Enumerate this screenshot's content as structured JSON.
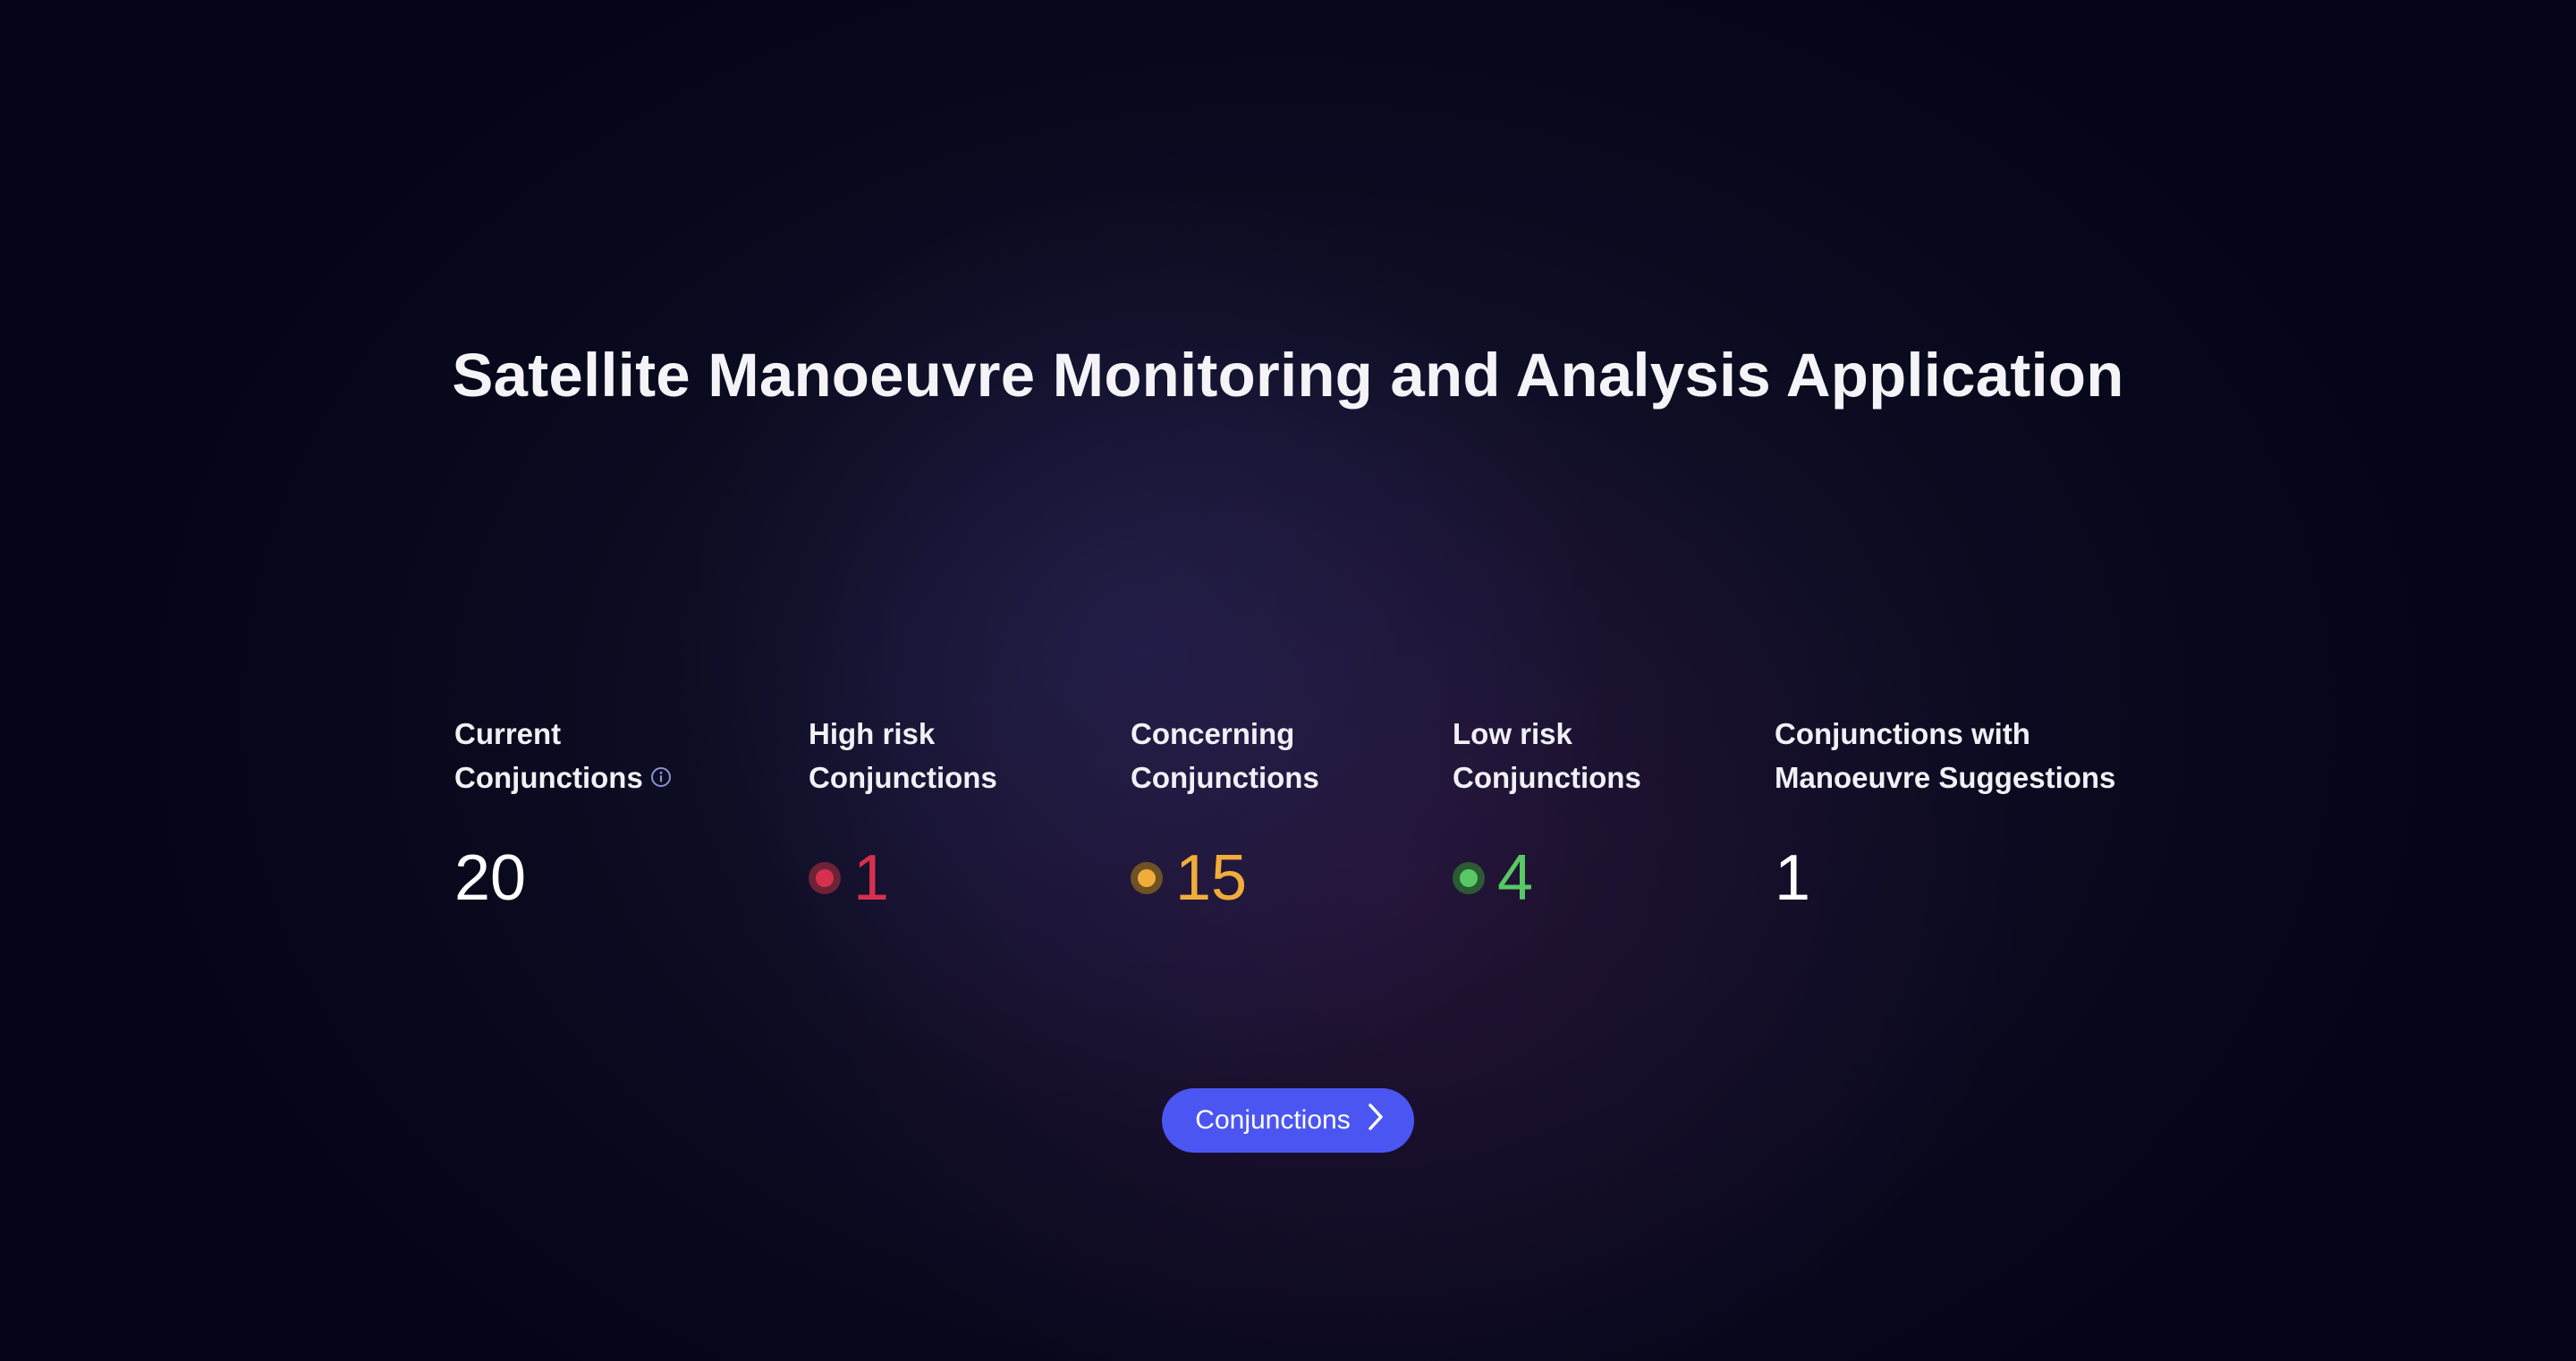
{
  "header": {
    "title": "Satellite Manoeuvre Monitoring and Analysis Application"
  },
  "stats": [
    {
      "label_line1": "Current",
      "label_line2": "Conjunctions",
      "value": "20",
      "icon": "info-icon",
      "color": "#ffffff"
    },
    {
      "label_line1": "High risk",
      "label_line2": "Conjunctions",
      "value": "1",
      "icon": "red-dot-icon",
      "color": "#d6304f"
    },
    {
      "label_line1": "Concerning",
      "label_line2": "Conjunctions",
      "value": "15",
      "icon": "amber-dot-icon",
      "color": "#f1ad3a"
    },
    {
      "label_line1": "Low risk",
      "label_line2": "Conjunctions",
      "value": "4",
      "icon": "green-dot-icon",
      "color": "#58c864"
    },
    {
      "label_line1": "Conjunctions with",
      "label_line2": "Manoeuvre Suggestions",
      "value": "1",
      "color": "#ffffff"
    }
  ],
  "actions": {
    "conjunctions_button_label": "Conjunctions",
    "button_icon": "chevron-right-icon",
    "accent": "#4b56f2"
  }
}
